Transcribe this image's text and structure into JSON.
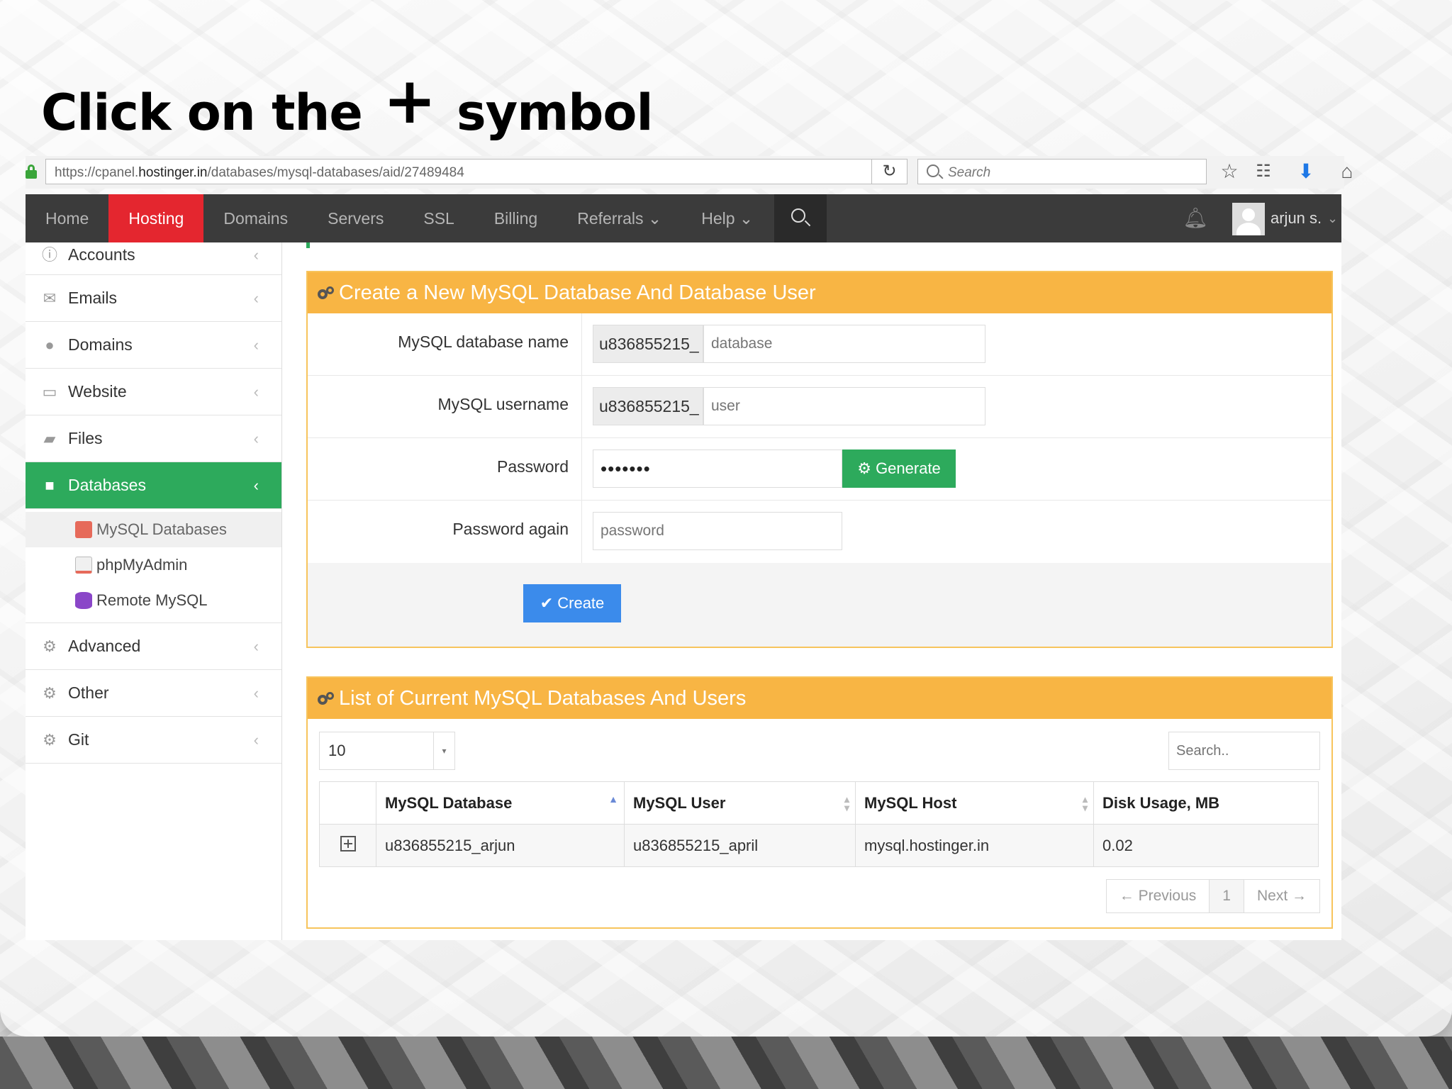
{
  "slide": {
    "heading_before": "Click on the",
    "heading_symbol": "+",
    "heading_after": "symbol"
  },
  "browser": {
    "url_prefix": "https://cpanel.",
    "url_host": "hostinger.in",
    "url_path": "/databases/mysql-databases/aid/27489484",
    "search_placeholder": "Search"
  },
  "nav": {
    "items": [
      "Home",
      "Hosting",
      "Domains",
      "Servers",
      "SSL",
      "Billing",
      "Referrals",
      "Help"
    ],
    "active": "Hosting",
    "user_name": "arjun s."
  },
  "sidebar": {
    "items": [
      {
        "label": "Accounts",
        "icon": "info-icon"
      },
      {
        "label": "Emails",
        "icon": "envelope-icon"
      },
      {
        "label": "Domains",
        "icon": "globe-icon"
      },
      {
        "label": "Website",
        "icon": "monitor-icon"
      },
      {
        "label": "Files",
        "icon": "folder-icon"
      },
      {
        "label": "Databases",
        "icon": "database-icon",
        "active": true
      },
      {
        "label": "Advanced",
        "icon": "gears-icon"
      },
      {
        "label": "Other",
        "icon": "gear-icon"
      },
      {
        "label": "Git",
        "icon": "gears-icon"
      }
    ],
    "sub_items": [
      {
        "label": "MySQL Databases",
        "active": true
      },
      {
        "label": "phpMyAdmin"
      },
      {
        "label": "Remote MySQL"
      }
    ]
  },
  "create_panel": {
    "title": "Create a New MySQL Database And Database User",
    "db_name_label": "MySQL database name",
    "db_prefix": "u836855215_",
    "db_placeholder": "database",
    "user_label": "MySQL username",
    "user_prefix": "u836855215_",
    "user_placeholder": "user",
    "password_label": "Password",
    "password_value": "•••••••",
    "generate_label": "Generate",
    "password_again_label": "Password again",
    "password_again_placeholder": "password",
    "create_label": "Create"
  },
  "list_panel": {
    "title": "List of Current MySQL Databases And Users",
    "page_size": "10",
    "search_placeholder": "Search..",
    "columns": [
      "MySQL Database",
      "MySQL User",
      "MySQL Host",
      "Disk Usage, MB"
    ],
    "rows": [
      {
        "db": "u836855215_arjun",
        "user": "u836855215_april",
        "host": "mysql.hostinger.in",
        "disk": "0.02"
      }
    ],
    "prev_label": "← Previous",
    "page": "1",
    "next_label": "Next →"
  },
  "colors": {
    "nav_bg": "#3b3b3b",
    "nav_active": "#e4262f",
    "sidebar_active": "#2daa5c",
    "panel_header": "#f8b544",
    "create_button": "#3b8beb",
    "generate_button": "#2daa5c"
  }
}
